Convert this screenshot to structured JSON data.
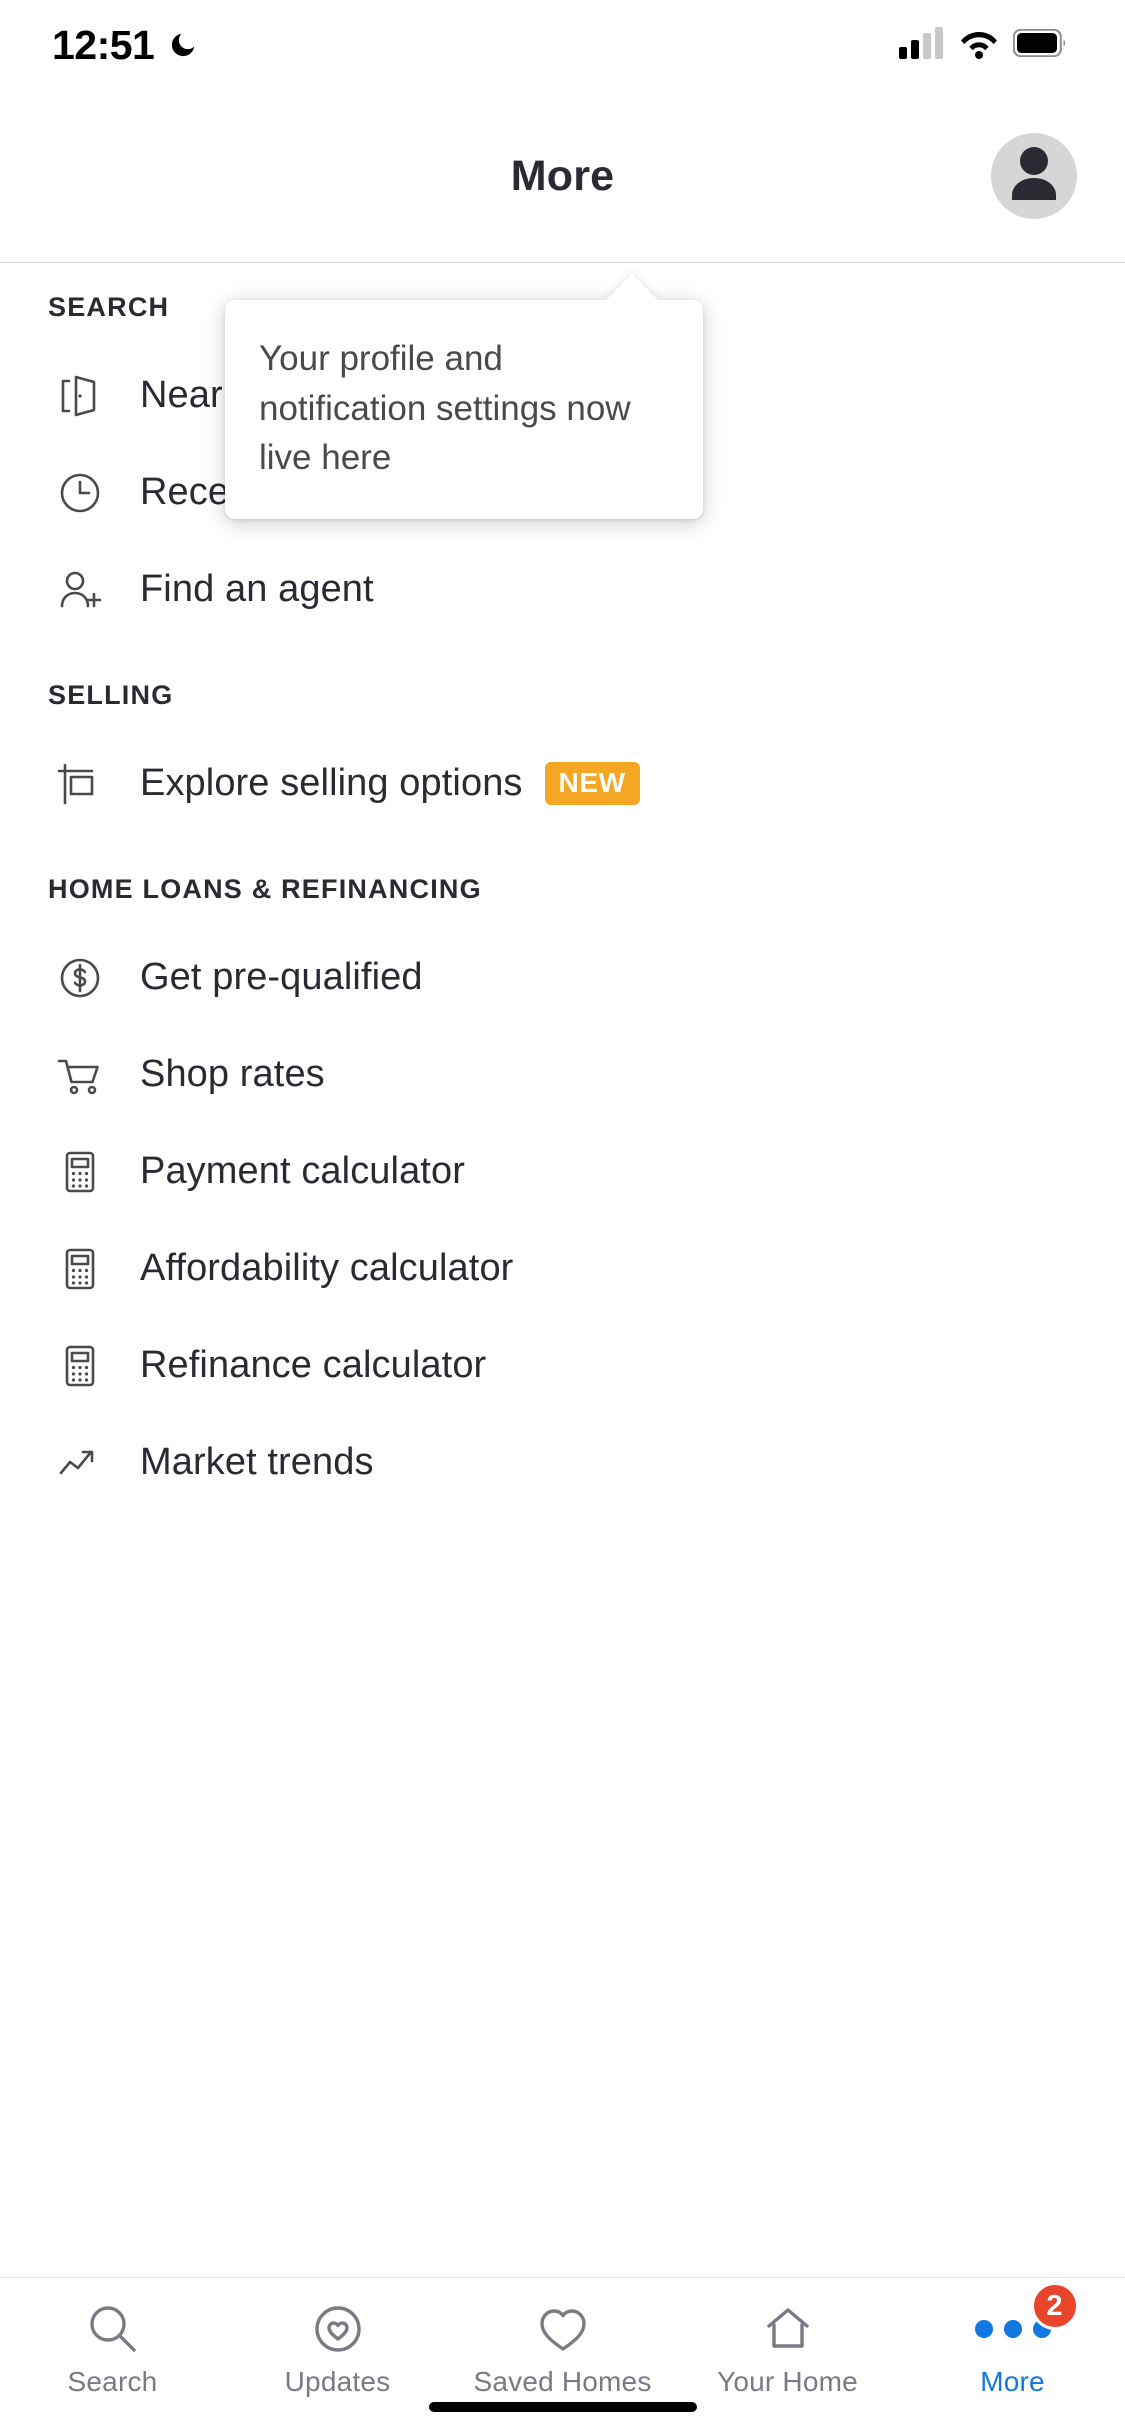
{
  "status_bar": {
    "time": "12:51",
    "moon_icon": "crescent-moon-icon",
    "cellular_icon": "cellular-signal-icon",
    "wifi_icon": "wifi-icon",
    "battery_icon": "battery-icon"
  },
  "header": {
    "title": "More",
    "avatar_icon": "person-avatar-icon"
  },
  "tooltip": {
    "text": "Your profile and notification settings now live here"
  },
  "sections": [
    {
      "title": "SEARCH",
      "items": [
        {
          "label": "Nearby homes",
          "icon": "open-door-icon",
          "badge": ""
        },
        {
          "label": "Recently viewed",
          "icon": "clock-icon",
          "badge": ""
        },
        {
          "label": "Find an agent",
          "icon": "person-add-icon",
          "badge": ""
        }
      ]
    },
    {
      "title": "SELLING",
      "items": [
        {
          "label": "Explore selling options",
          "icon": "for-sale-sign-icon",
          "badge": "NEW"
        }
      ]
    },
    {
      "title": "HOME LOANS & REFINANCING",
      "items": [
        {
          "label": "Get pre-qualified",
          "icon": "dollar-circle-icon",
          "badge": ""
        },
        {
          "label": "Shop rates",
          "icon": "shopping-cart-icon",
          "badge": ""
        },
        {
          "label": "Payment calculator",
          "icon": "calculator-icon",
          "badge": ""
        },
        {
          "label": "Affordability calculator",
          "icon": "calculator-icon",
          "badge": ""
        },
        {
          "label": "Refinance calculator",
          "icon": "calculator-icon",
          "badge": ""
        },
        {
          "label": "Market trends",
          "icon": "trend-up-icon",
          "badge": ""
        }
      ]
    }
  ],
  "tabbar": {
    "tabs": [
      {
        "label": "Search",
        "icon": "magnifier-icon",
        "active": false,
        "badge": ""
      },
      {
        "label": "Updates",
        "icon": "heart-in-circle-icon",
        "active": false,
        "badge": ""
      },
      {
        "label": "Saved Homes",
        "icon": "heart-icon",
        "active": false,
        "badge": ""
      },
      {
        "label": "Your Home",
        "icon": "house-icon",
        "active": false,
        "badge": ""
      },
      {
        "label": "More",
        "icon": "three-dots-icon",
        "active": true,
        "badge": "2"
      }
    ]
  },
  "colors": {
    "accent_blue": "#1277e1",
    "badge_orange": "#f5a623",
    "badge_red": "#e8452b",
    "text_dark": "#2a2a33",
    "text_muted": "#7a7a85"
  }
}
